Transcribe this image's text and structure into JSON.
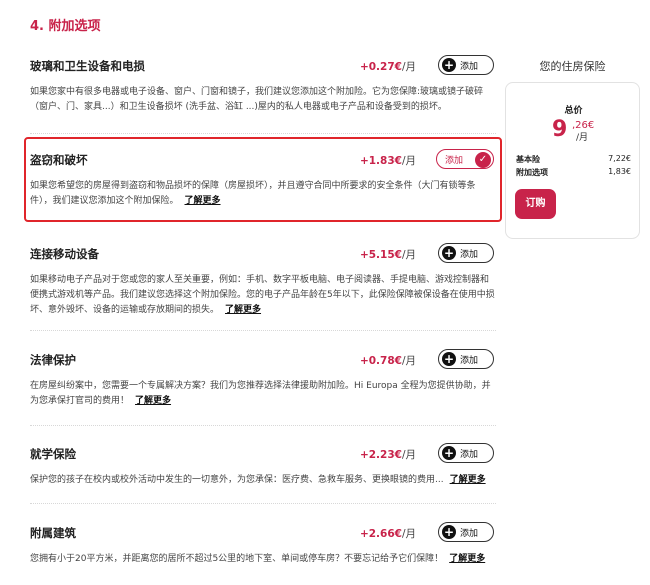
{
  "section_title": "4. 附加选项",
  "add_label": "添加",
  "more_label": "了解更多",
  "unit": "/月",
  "options": [
    {
      "name": "玻璃和卫生设备和电损",
      "price": "+0.27€",
      "desc": "如果您家中有很多电器或电子设备、窗户、门窗和镜子，我们建议您添加这个附加险。它为您保障:玻璃或镜子破碎（窗户、门、家具...）和卫生设备损坏 (洗手盆、浴缸 ...)屋内的私人电器或电子产品和设备受到的损坏。",
      "selected": false
    },
    {
      "name": "盗窃和破坏",
      "price": "+1.83€",
      "desc": "如果您希望您的房屋得到盗窃和物品损坏的保障（房屋损坏），并且遵守合同中所要求的安全条件（大门有锁等条件），我们建议您添加这个附加保险。",
      "selected": true
    },
    {
      "name": "连接移动设备",
      "price": "+5.15€",
      "desc": "如果移动电子产品对于您或您的家人至关重要，例如：手机、数字平板电脑、电子阅读器、手提电脑、游戏控制器和便携式游戏机等产品。我们建议您选择这个附加保险。您的电子产品年龄在5年以下，此保险保障被保设备在使用中损坏、意外毁坏、设备的运输或存放期间的损失。",
      "selected": false
    },
    {
      "name": "法律保护",
      "price": "+0.78€",
      "desc": "在房屋纠纷案中，您需要一个专属解决方案？我们为您推荐选择法律援助附加险。Hi Europa 全程为您提供协助，并为您承保打官司的费用！",
      "selected": false
    },
    {
      "name": "就学保险",
      "price": "+2.23€",
      "desc": "保护您的孩子在校内或校外活动中发生的一切意外，为您承保：医疗费、急救车服务、更换眼镜的费用...",
      "selected": false
    },
    {
      "name": "附属建筑",
      "price": "+2.66€",
      "desc": "您拥有小于20平方米，并距离您的居所不超过5公里的地下室、单间或停车房？不要忘记给予它们保障！",
      "selected": false
    }
  ],
  "sidebar": {
    "title": "您的住房保险",
    "total_label": "总价",
    "price_int": "9",
    "price_dec": ",26€",
    "price_unit": "/月",
    "base_label": "基本险",
    "base_value": "7,22€",
    "addon_label": "附加选项",
    "addon_value": "1,83€",
    "buy_label": "订购"
  },
  "colors": {
    "accent": "#c8234a",
    "highlight_border": "#e0252b"
  },
  "icons": {
    "add": "plus-icon",
    "selected": "check-icon"
  }
}
